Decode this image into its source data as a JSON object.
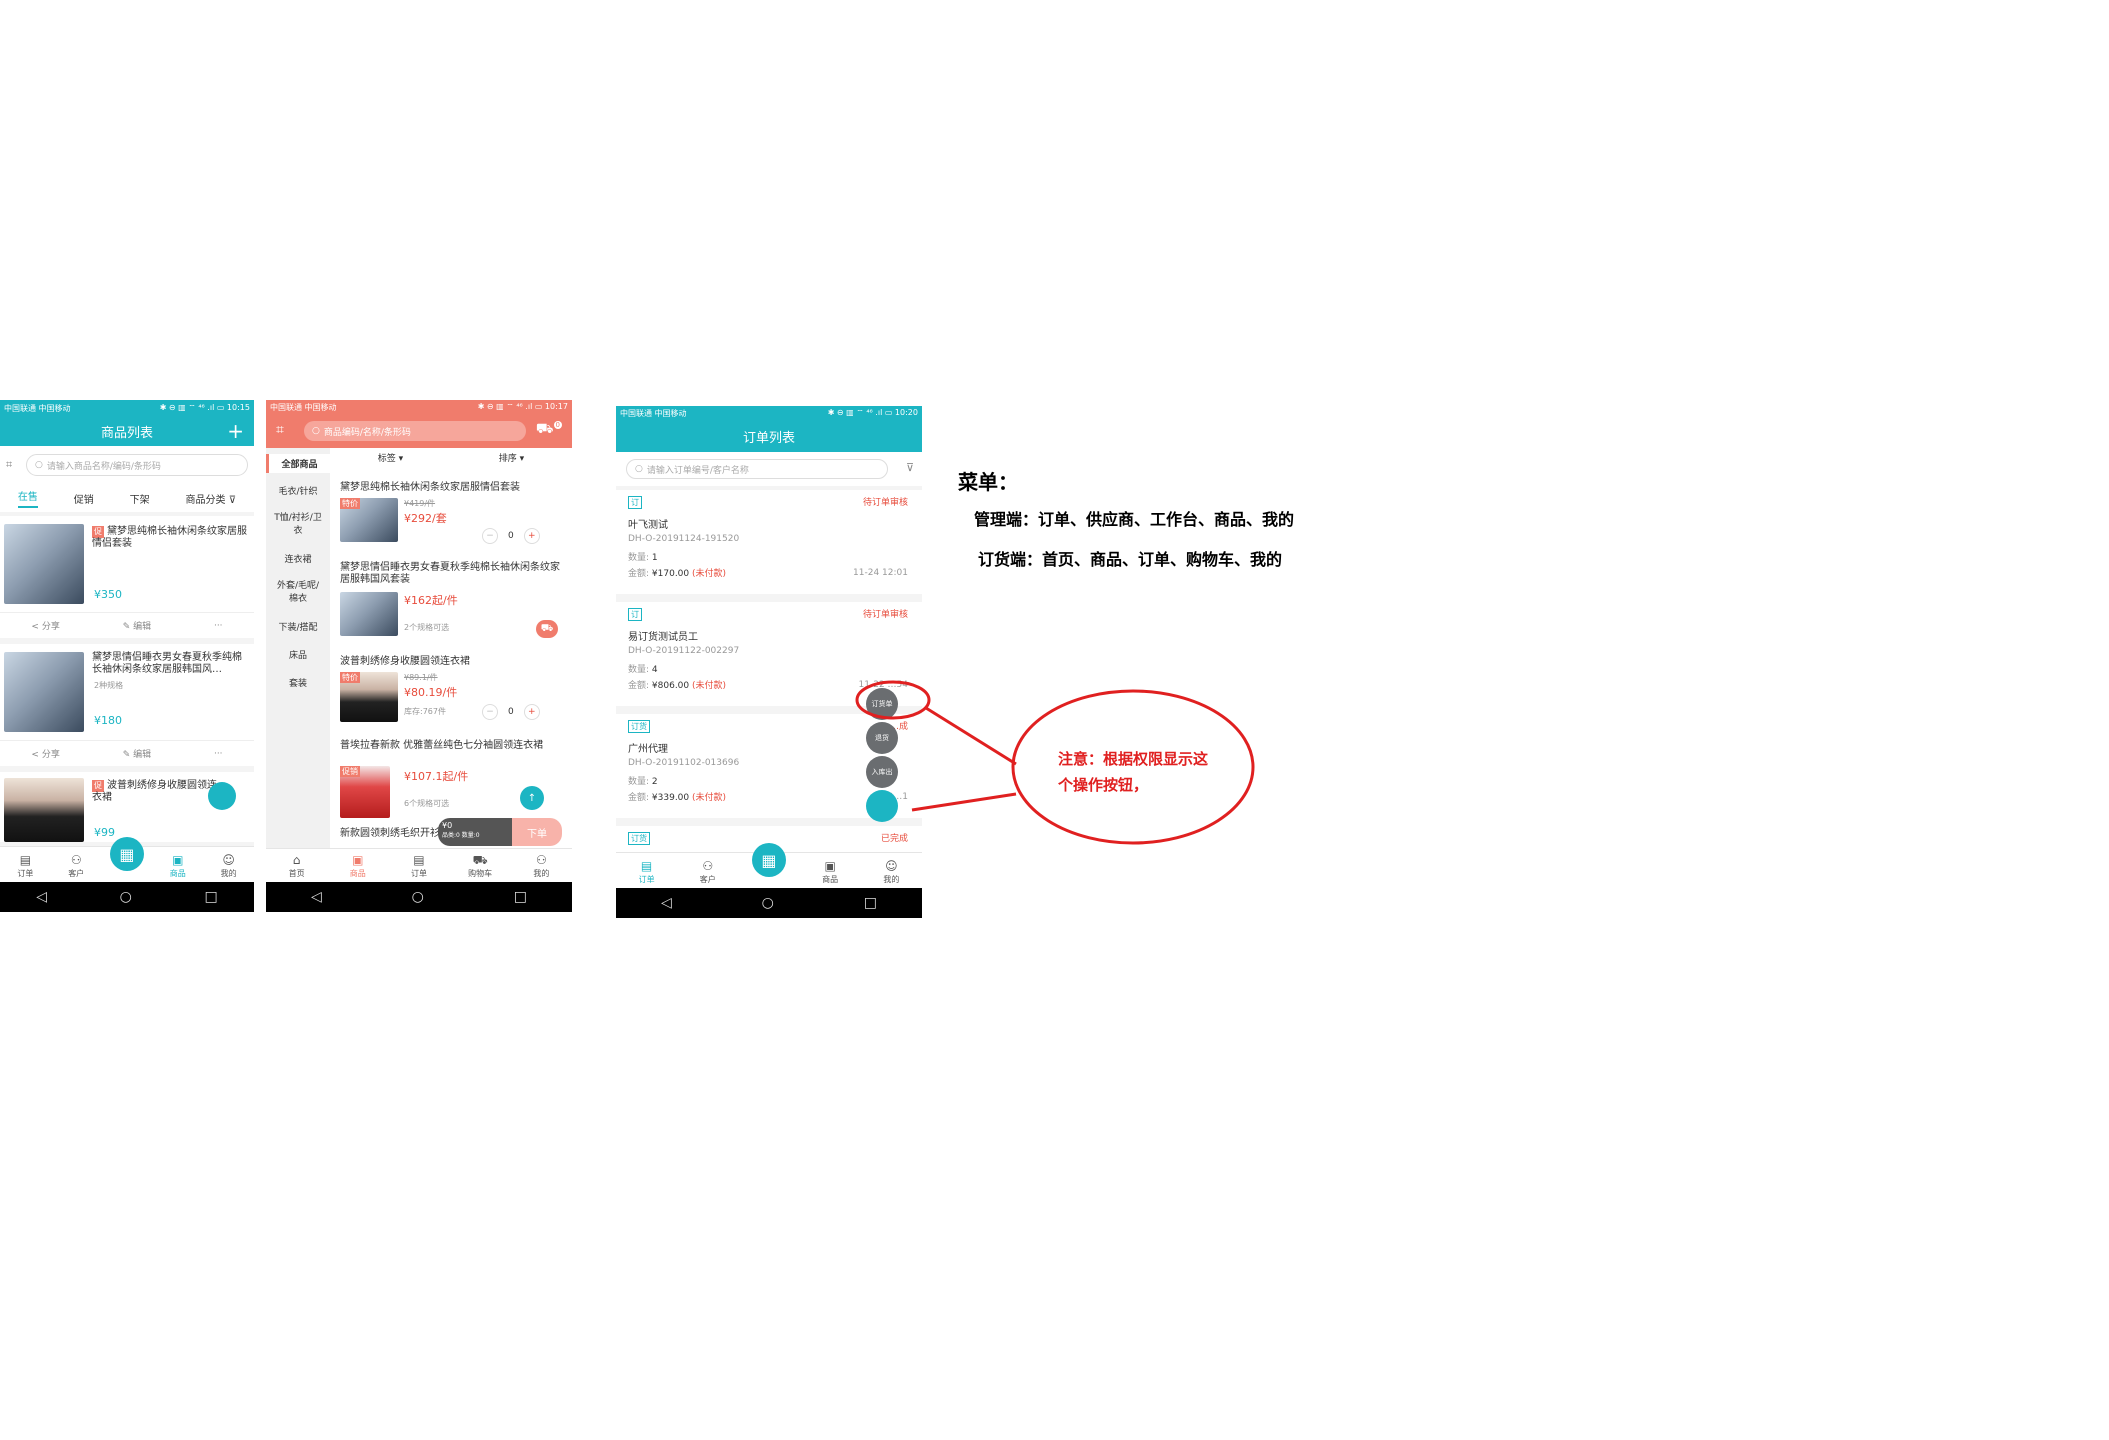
{
  "phone1": {
    "status_left": "中国联通 中国移动",
    "status_right": "✱ ⊖ ▥ ⌔ ⁴⁶ .ıl ▭ 10:15",
    "title": "商品列表",
    "add_icon": "plus-icon",
    "search_placeholder": "请输入商品名称/编码/条形码",
    "tabs": [
      "在售",
      "促销",
      "下架",
      "商品分类"
    ],
    "products": [
      {
        "title": "黛梦思纯棉长袖休闲条纹家居服情侣套装",
        "price": "¥350",
        "share": "分享",
        "edit": "编辑",
        "more": "···"
      },
      {
        "title": "黛梦思情侣睡衣男女春夏秋季纯棉长袖休闲条纹家居服韩国风…",
        "sub": "2种规格",
        "price": "¥180",
        "share": "分享",
        "edit": "编辑",
        "more": "···"
      },
      {
        "title": "波普刺绣修身收腰圆领连衣裙",
        "price": "¥99"
      }
    ],
    "tabbar": [
      "订单",
      "客户",
      "",
      "商品",
      "我的"
    ],
    "active_tab": 3
  },
  "phone2": {
    "status_left": "中国联通 中国移动",
    "status_right": "✱ ⊖ ▥ ⌔ ⁴⁶ .ıl ▭ 10:17",
    "search_placeholder": "商品编码/名称/条形码",
    "cart_count": "0",
    "filters": [
      "标签",
      "排序"
    ],
    "categories": [
      "全部商品",
      "毛衣/针织",
      "T恤/衬衫/卫衣",
      "连衣裙",
      "外套/毛呢/棉衣",
      "下装/搭配",
      "床品",
      "套装"
    ],
    "products": [
      {
        "title": "黛梦思纯棉长袖休闲条纹家居服情侣套装",
        "tag": "特价",
        "old_price": "¥419/件",
        "price": "¥292/套",
        "qty": "0"
      },
      {
        "title": "黛梦思情侣睡衣男女春夏秋季纯棉长袖休闲条纹家居服韩国风套装",
        "price": "¥162起/件",
        "spec": "2个规格可选"
      },
      {
        "title": "波普刺绣修身收腰圆领连衣裙",
        "tag": "特价",
        "old_price": "¥89.1/件",
        "price": "¥80.19/件",
        "stock": "库存:767件",
        "qty": "0"
      },
      {
        "title": "普埃拉春新款 优雅蕾丝纯色七分袖圆领连衣裙",
        "tag": "促销",
        "price": "¥107.1起/件",
        "spec": "6个规格可选"
      },
      {
        "title": "新款圆领刺绣毛织开衫"
      }
    ],
    "cart_bar": {
      "amount": "¥0",
      "summary": "品类:0 数量:0",
      "order_btn": "下单"
    },
    "tabbar": [
      "首页",
      "商品",
      "订单",
      "购物车",
      "我的"
    ],
    "active_tab": 1
  },
  "phone3": {
    "status_left": "中国联通 中国移动",
    "status_right": "✱ ⊖ ▥ ⌔ ⁴⁶ .ıl ▭ 10:20",
    "title": "订单列表",
    "search_placeholder": "请输入订单编号/客户名称",
    "orders": [
      {
        "tag": "订",
        "status": "待订单审核",
        "name": "叶飞测试",
        "code": "DH-O-20191124-191520",
        "qty_label": "数量:",
        "qty": "1",
        "amount_label": "金额:",
        "amount": "¥170.00",
        "pay": "(未付款)",
        "time": "11-24 12:01"
      },
      {
        "tag": "订",
        "status": "待订单审核",
        "name": "易订货测试员工",
        "code": "DH-O-20191122-002297",
        "qty_label": "数量:",
        "qty": "4",
        "amount_label": "金额:",
        "amount": "¥806.00",
        "pay": "(未付款)",
        "time": "11-22 …54"
      },
      {
        "tag": "订货",
        "status": "…成",
        "name": "广州代理",
        "code": "DH-O-20191102-013696",
        "qty_label": "数量:",
        "qty": "2",
        "amount_label": "金额:",
        "amount": "¥339.00",
        "pay": "(未付款)",
        "time": "11-0…1"
      },
      {
        "tag": "订货",
        "status": "已完成"
      }
    ],
    "fab_menu": [
      "订货单",
      "退货",
      "入库出"
    ],
    "tabbar": [
      "订单",
      "客户",
      "",
      "商品",
      "我的"
    ],
    "active_tab": 0
  },
  "menu": {
    "heading": "菜单：",
    "line1": "管理端：订单、供应商、工作台、商品、我的",
    "line2": "订货端：首页、商品、订单、购物车、我的"
  },
  "note": {
    "line1": "注意：根据权限显示这",
    "line2": "个操作按钮，"
  },
  "colors": {
    "teal": "#1cb5c3",
    "salmon": "#f07c6c",
    "annotation_red": "#e02020"
  }
}
